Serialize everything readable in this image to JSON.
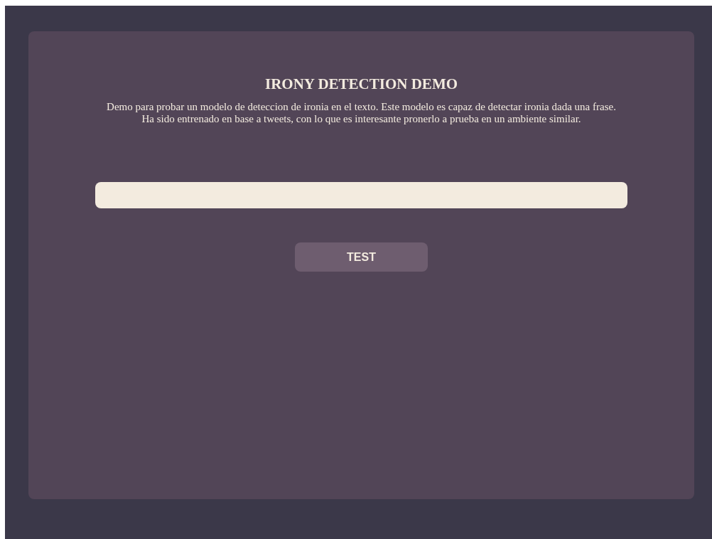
{
  "title": "IRONY DETECTION DEMO",
  "description": "Demo para probar un modelo de deteccion de ironia en el texto. Este modelo es capaz de detectar ironia dada una frase. Ha sido entrenado en base a tweets, con lo que es interesante pronerlo a prueba en un ambiente similar.",
  "button": "TEST"
}
